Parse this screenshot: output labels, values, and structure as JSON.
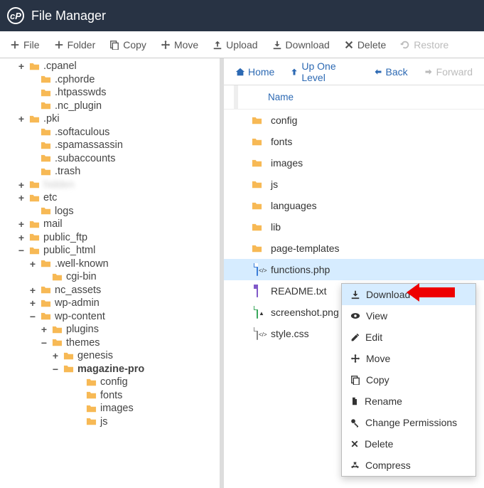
{
  "app": {
    "title": "File Manager"
  },
  "toolbar": [
    {
      "icon": "plus",
      "label": "File"
    },
    {
      "icon": "plus",
      "label": "Folder"
    },
    {
      "icon": "copy",
      "label": "Copy"
    },
    {
      "icon": "move",
      "label": "Move"
    },
    {
      "icon": "upload",
      "label": "Upload"
    },
    {
      "icon": "download",
      "label": "Download"
    },
    {
      "icon": "delete",
      "label": "Delete"
    },
    {
      "icon": "restore",
      "label": "Restore",
      "disabled": true
    }
  ],
  "tree": [
    {
      "exp": "+",
      "indent": 1,
      "label": ".cpanel"
    },
    {
      "exp": "",
      "indent": 2,
      "label": ".cphorde"
    },
    {
      "exp": "",
      "indent": 2,
      "label": ".htpasswds"
    },
    {
      "exp": "",
      "indent": 2,
      "label": ".nc_plugin"
    },
    {
      "exp": "+",
      "indent": 1,
      "label": ".pki"
    },
    {
      "exp": "",
      "indent": 2,
      "label": ".softaculous"
    },
    {
      "exp": "",
      "indent": 2,
      "label": ".spamassassin"
    },
    {
      "exp": "",
      "indent": 2,
      "label": ".subaccounts"
    },
    {
      "exp": "",
      "indent": 2,
      "label": ".trash"
    },
    {
      "exp": "+",
      "indent": 1,
      "label": "hidden",
      "blur": true
    },
    {
      "exp": "+",
      "indent": 1,
      "label": "etc"
    },
    {
      "exp": "",
      "indent": 2,
      "label": "logs"
    },
    {
      "exp": "+",
      "indent": 1,
      "label": "mail"
    },
    {
      "exp": "+",
      "indent": 1,
      "label": "public_ftp"
    },
    {
      "exp": "−",
      "indent": 1,
      "label": "public_html"
    },
    {
      "exp": "+",
      "indent": 2,
      "label": ".well-known"
    },
    {
      "exp": "",
      "indent": 3,
      "label": "cgi-bin"
    },
    {
      "exp": "+",
      "indent": 2,
      "label": "nc_assets"
    },
    {
      "exp": "+",
      "indent": 2,
      "label": "wp-admin"
    },
    {
      "exp": "−",
      "indent": 2,
      "label": "wp-content"
    },
    {
      "exp": "+",
      "indent": 3,
      "label": "plugins"
    },
    {
      "exp": "−",
      "indent": 3,
      "label": "themes"
    },
    {
      "exp": "+",
      "indent": 4,
      "label": "genesis"
    },
    {
      "exp": "−",
      "indent": 4,
      "label": "magazine-pro",
      "bold": true
    },
    {
      "exp": "",
      "indent": 6,
      "label": "config"
    },
    {
      "exp": "",
      "indent": 6,
      "label": "fonts"
    },
    {
      "exp": "",
      "indent": 6,
      "label": "images"
    },
    {
      "exp": "",
      "indent": 6,
      "label": "js"
    }
  ],
  "crumbs": [
    {
      "icon": "home",
      "label": "Home"
    },
    {
      "icon": "up",
      "label": "Up One Level"
    },
    {
      "icon": "back",
      "label": "Back"
    },
    {
      "icon": "forward",
      "label": "Forward",
      "disabled": true
    }
  ],
  "list_header": "Name",
  "files": [
    {
      "type": "folder",
      "label": "config"
    },
    {
      "type": "folder",
      "label": "fonts"
    },
    {
      "type": "folder",
      "label": "images"
    },
    {
      "type": "folder",
      "label": "js"
    },
    {
      "type": "folder",
      "label": "languages"
    },
    {
      "type": "folder",
      "label": "lib"
    },
    {
      "type": "folder",
      "label": "page-templates"
    },
    {
      "type": "php",
      "label": "functions.php",
      "sel": true
    },
    {
      "type": "txt",
      "label": "README.txt"
    },
    {
      "type": "png",
      "label": "screenshot.png"
    },
    {
      "type": "css",
      "label": "style.css"
    }
  ],
  "context_menu": [
    {
      "icon": "download",
      "label": "Download",
      "hi": true
    },
    {
      "icon": "view",
      "label": "View"
    },
    {
      "icon": "edit",
      "label": "Edit"
    },
    {
      "icon": "move",
      "label": "Move"
    },
    {
      "icon": "copy",
      "label": "Copy"
    },
    {
      "icon": "rename",
      "label": "Rename"
    },
    {
      "icon": "perm",
      "label": "Change Permissions"
    },
    {
      "icon": "delete",
      "label": "Delete"
    },
    {
      "icon": "compress",
      "label": "Compress"
    }
  ]
}
